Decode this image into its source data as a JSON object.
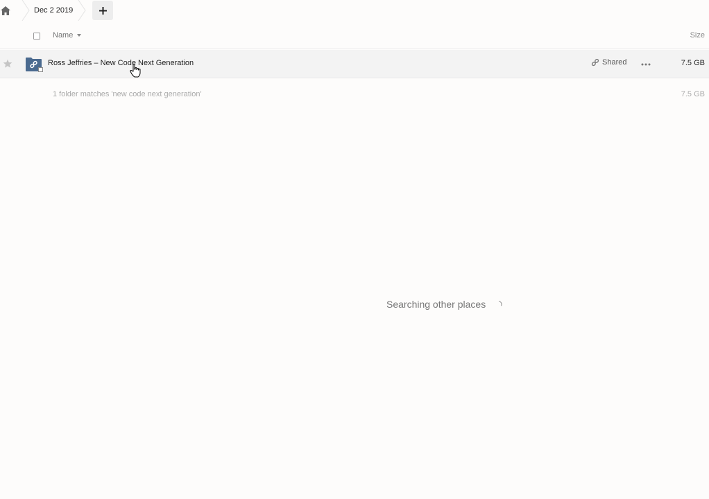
{
  "breadcrumb": {
    "home_icon": "home-icon",
    "current_folder": "Dec 2 2019",
    "new_button_icon": "plus-icon"
  },
  "header": {
    "name_label": "Name",
    "size_label": "Size"
  },
  "files": [
    {
      "name": "Ross Jeffries – New Code Next Generation",
      "type_icon": "shared-folder-link-icon",
      "share_label": "Shared",
      "size": "7.5 GB",
      "favorite": false
    }
  ],
  "summary": {
    "text": "1 folder matches 'new code next generation'",
    "size": "7.5 GB"
  },
  "status": {
    "searching_text": "Searching other places"
  },
  "colors": {
    "folder_blue": "#4a6a8f",
    "row_highlight": "#f3f3f3",
    "background": "#fdfcfb"
  }
}
